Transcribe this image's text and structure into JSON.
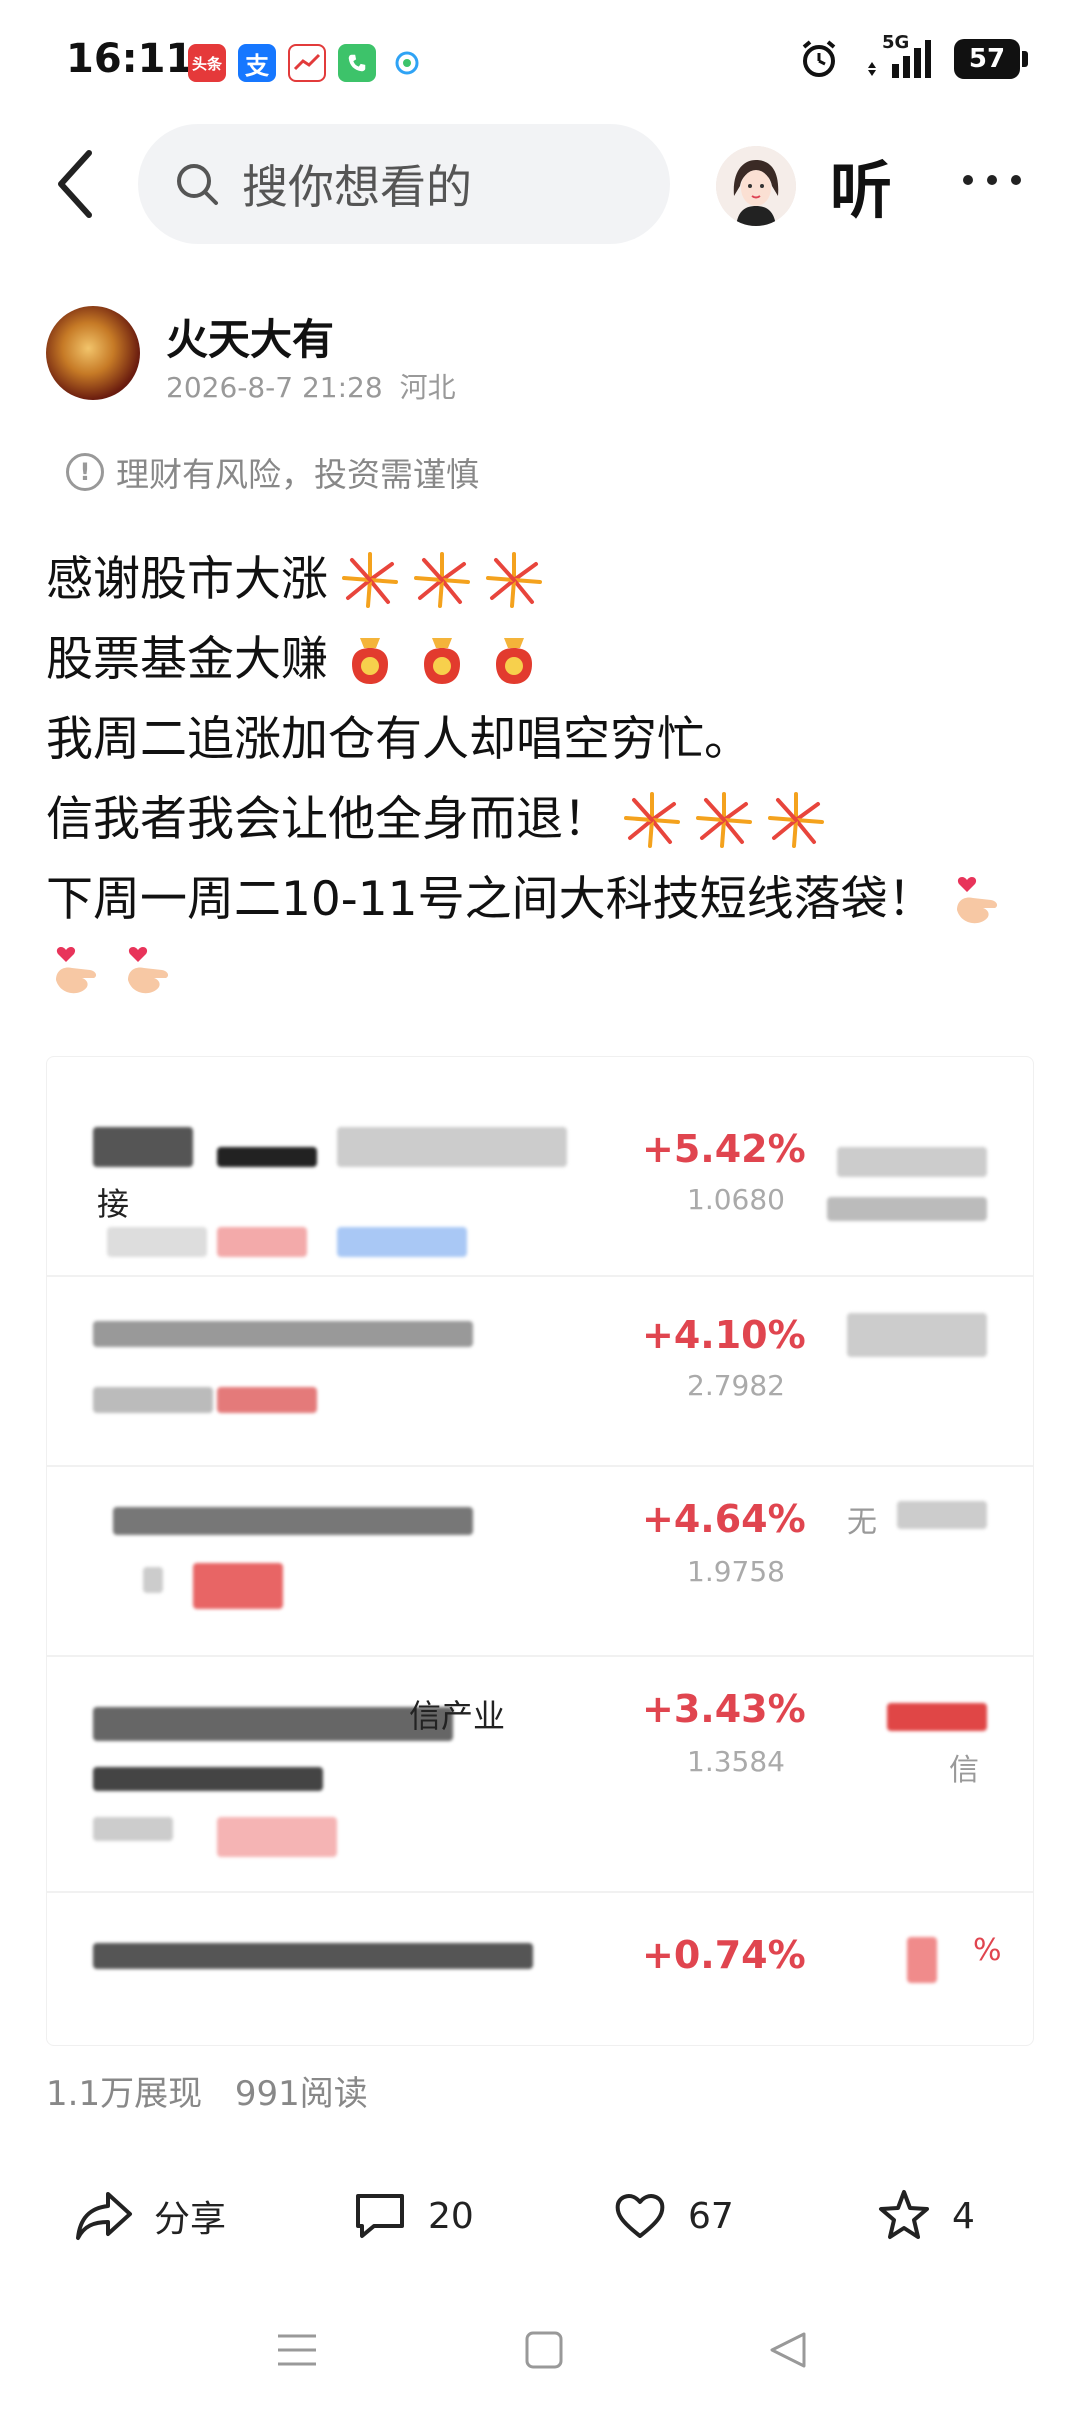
{
  "status_bar": {
    "time": "16:11",
    "apps": [
      {
        "name": "toutiao-icon",
        "label": "头条",
        "color": "#e5393a"
      },
      {
        "name": "alipay-icon",
        "label": "支",
        "color": "#1677ff"
      },
      {
        "name": "stock-app-icon",
        "label": "",
        "color": "#e23b3b"
      },
      {
        "name": "phone-app-icon",
        "label": "",
        "color": "#3dc36a"
      },
      {
        "name": "mobile-app-icon",
        "label": "",
        "color": "#2fa3f5"
      }
    ],
    "network": "5G",
    "battery": "57"
  },
  "top_nav": {
    "search_placeholder": "搜你想看的",
    "listen_label": "听"
  },
  "author": {
    "name": "火天大有",
    "datetime": "2026-8-7 21:28",
    "location": "河北"
  },
  "risk_tip": "理财有风险，投资需谨慎",
  "post": {
    "lines": [
      "感谢股市大涨",
      "股票基金大赚",
      "我周二追涨加仓有人却唱空穷忙。",
      "信我者我会让他全身而退！",
      "下周一周二10-11号之间大科技短线落袋！"
    ]
  },
  "image": {
    "funds": [
      {
        "label": "接",
        "pct": "+5.42%",
        "nav": "1.0680"
      },
      {
        "label": "",
        "pct": "+4.10%",
        "nav": "2.7982"
      },
      {
        "label": "",
        "pct": "+4.64%",
        "nav": "1.9758",
        "side": "无"
      },
      {
        "label": "信产业",
        "pct": "+3.43%",
        "nav": "1.3584",
        "side": "信"
      },
      {
        "label": "",
        "pct": "+0.74%",
        "nav": "",
        "side": "%"
      }
    ]
  },
  "stats": {
    "impressions": "1.1万展现",
    "reads": "991阅读"
  },
  "actions": {
    "share_label": "分享",
    "comment_count": "20",
    "like_count": "67",
    "favorite_count": "4"
  },
  "colors": {
    "accent_red": "#e0454f",
    "text_primary": "#111111",
    "text_secondary": "#888888"
  }
}
